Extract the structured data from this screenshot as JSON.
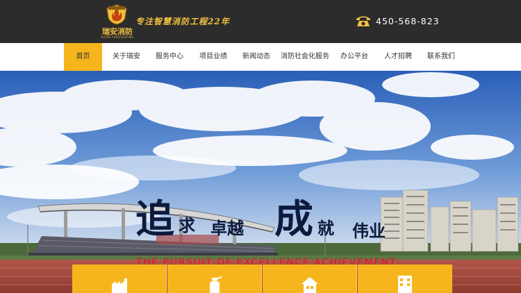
{
  "header": {
    "logo_title": "瑞安消防",
    "logo_subtitle": "RUIAN FIREFIGHTING",
    "slogan": "专注智慧消防工程22年",
    "phone_icon": "telephone-icon",
    "phone_number": "450-568-823"
  },
  "nav": {
    "items": [
      {
        "label": "首页",
        "active": true
      },
      {
        "label": "关于瑞安",
        "active": false
      },
      {
        "label": "服务中心",
        "active": false
      },
      {
        "label": "项目业绩",
        "active": false
      },
      {
        "label": "新闻动态",
        "active": false
      },
      {
        "label": "消防社会化服务",
        "active": false
      },
      {
        "label": "办公平台",
        "active": false
      },
      {
        "label": "人才招聘",
        "active": false
      },
      {
        "label": "联系我们",
        "active": false
      }
    ]
  },
  "banner": {
    "headline": {
      "big1": "追",
      "small1": "求",
      "small2": "卓越",
      "big2": "成",
      "small3": "就",
      "small4": "伟业"
    },
    "subtitle": "THE PURSUIT OF EXCELLENCE ACHIEVEMENT"
  },
  "cards": [
    {
      "icon": "factory-icon"
    },
    {
      "icon": "fire-extinguisher-icon"
    },
    {
      "icon": "house-icon"
    },
    {
      "icon": "office-building-icon"
    }
  ],
  "colors": {
    "accent": "#f7b51d",
    "header_bg": "#2c2c2c",
    "headline": "#0c1a3c",
    "subtitle": "#d22020"
  }
}
